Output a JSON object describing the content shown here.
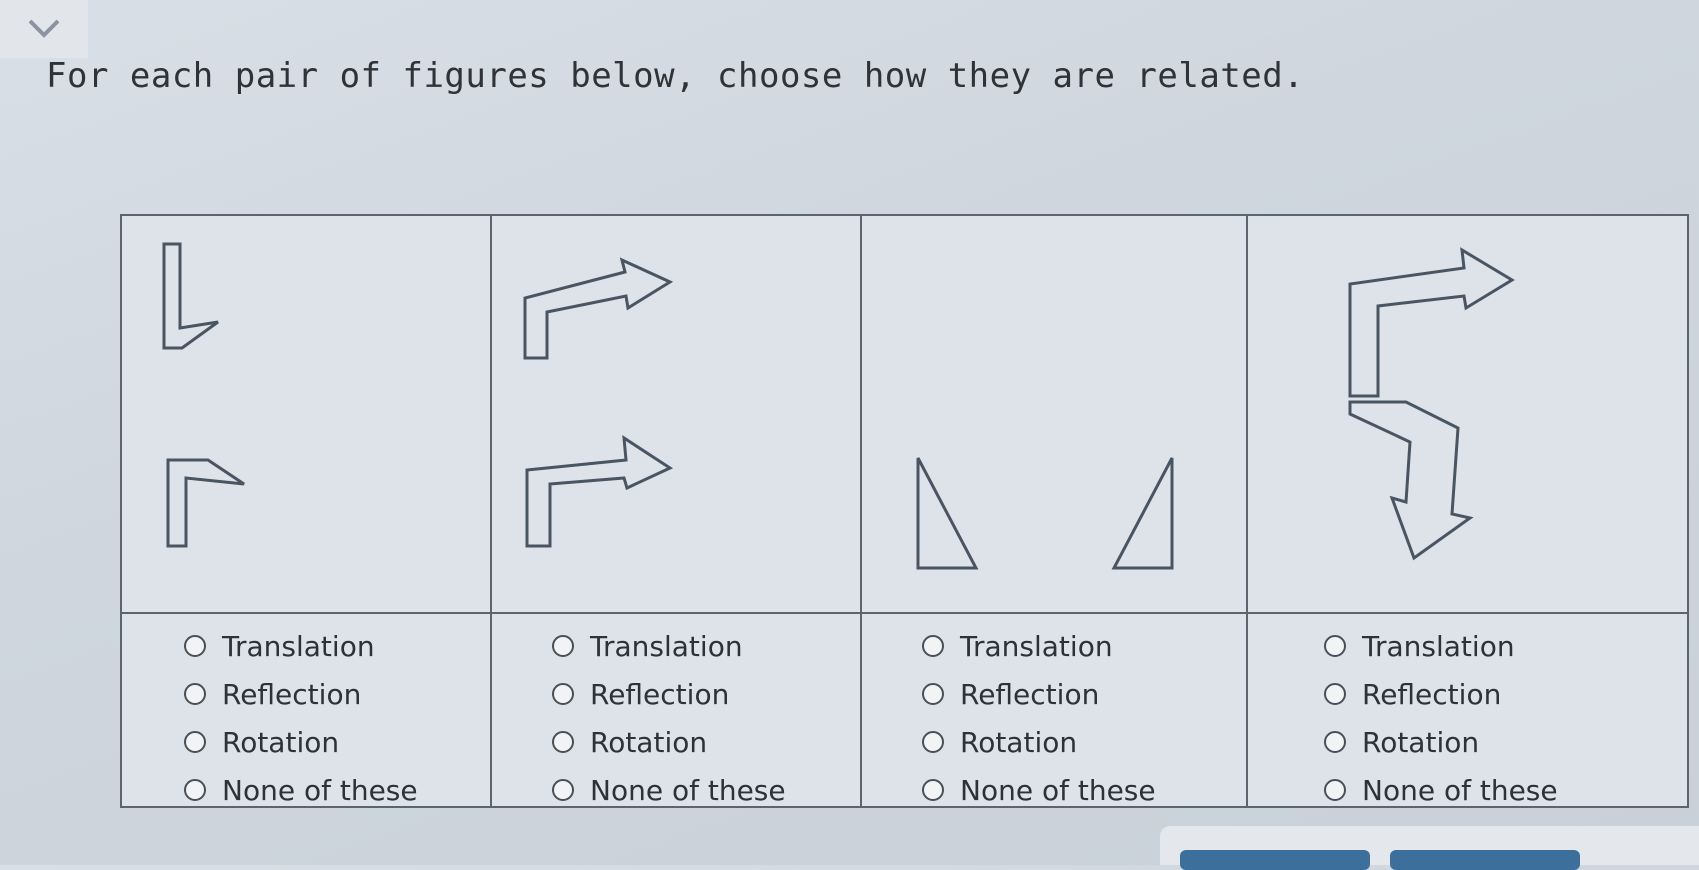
{
  "header": {
    "collapse_icon": "chevron-down-icon",
    "prompt": "For each pair of figures below, choose how they are related."
  },
  "pairs": [
    {
      "figures": "bent-l-shapes",
      "options": [
        "Translation",
        "Reflection",
        "Rotation",
        "None of these"
      ]
    },
    {
      "figures": "arrow-shapes",
      "options": [
        "Translation",
        "Reflection",
        "Rotation",
        "None of these"
      ]
    },
    {
      "figures": "right-triangles",
      "options": [
        "Translation",
        "Reflection",
        "Rotation",
        "None of these"
      ]
    },
    {
      "figures": "stacked-arrows",
      "options": [
        "Translation",
        "Reflection",
        "Rotation",
        "None of these"
      ]
    }
  ],
  "colors": {
    "outline": "#4a5563",
    "grid_border": "#5c6470",
    "button": "#3d6f9c"
  }
}
